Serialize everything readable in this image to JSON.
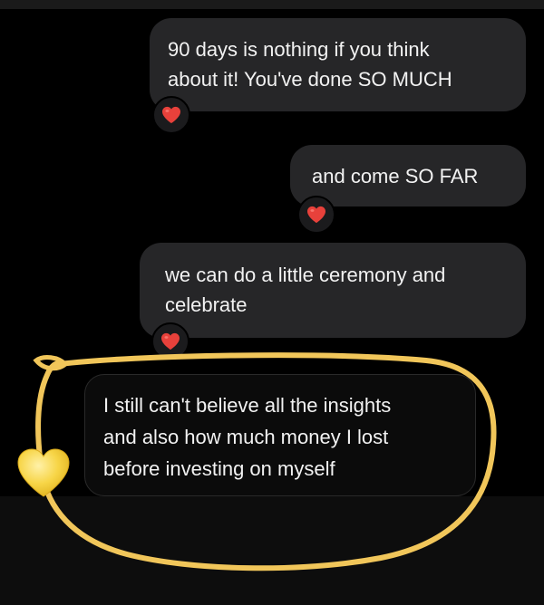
{
  "messages": [
    {
      "text": "90 days is nothing if you think\nabout it! You've done SO MUCH",
      "reaction": "red-heart"
    },
    {
      "text": "and come SO FAR",
      "reaction": "red-heart"
    },
    {
      "text": "we can do a little ceremony and\ncelebrate",
      "reaction": "red-heart"
    },
    {
      "text": "I still can't believe all the insights\nand also how much money I lost\nbefore investing on myself",
      "highlighted": true
    }
  ],
  "colors": {
    "background": "#000000",
    "bubble": "#262628",
    "bubble_text": "#f2f2f2",
    "reaction_heart": "#e8413b",
    "annotation_circle": "#f1c65a",
    "annotation_heart": "#f7d547"
  },
  "icons": {
    "reaction": "red-heart-icon",
    "annotation": "yellow-heart-icon"
  }
}
